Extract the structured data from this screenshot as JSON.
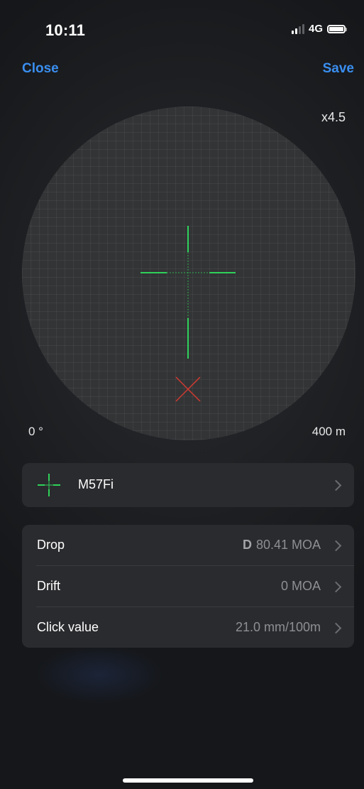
{
  "status_bar": {
    "time": "10:11",
    "network": "4G",
    "signal_bars": 2,
    "signal_bars_total": 4,
    "battery_level": 1.0
  },
  "nav": {
    "close_label": "Close",
    "save_label": "Save"
  },
  "scope": {
    "zoom": "x4.5",
    "angle": "0 °",
    "distance": "400 m",
    "reticle_color": "#2fd15a",
    "impact_marker_color": "#d23b30"
  },
  "reticle_selector": {
    "name": "M57Fi"
  },
  "settings": [
    {
      "label": "Drop",
      "prefix": "D",
      "value": "80.41 MOA"
    },
    {
      "label": "Drift",
      "prefix": "",
      "value": "0 MOA"
    },
    {
      "label": "Click value",
      "prefix": "",
      "value": "21.0 mm/100m"
    }
  ],
  "colors": {
    "accent": "#3a8ef0",
    "background": "#17191c",
    "card": "#2a2b2e"
  }
}
